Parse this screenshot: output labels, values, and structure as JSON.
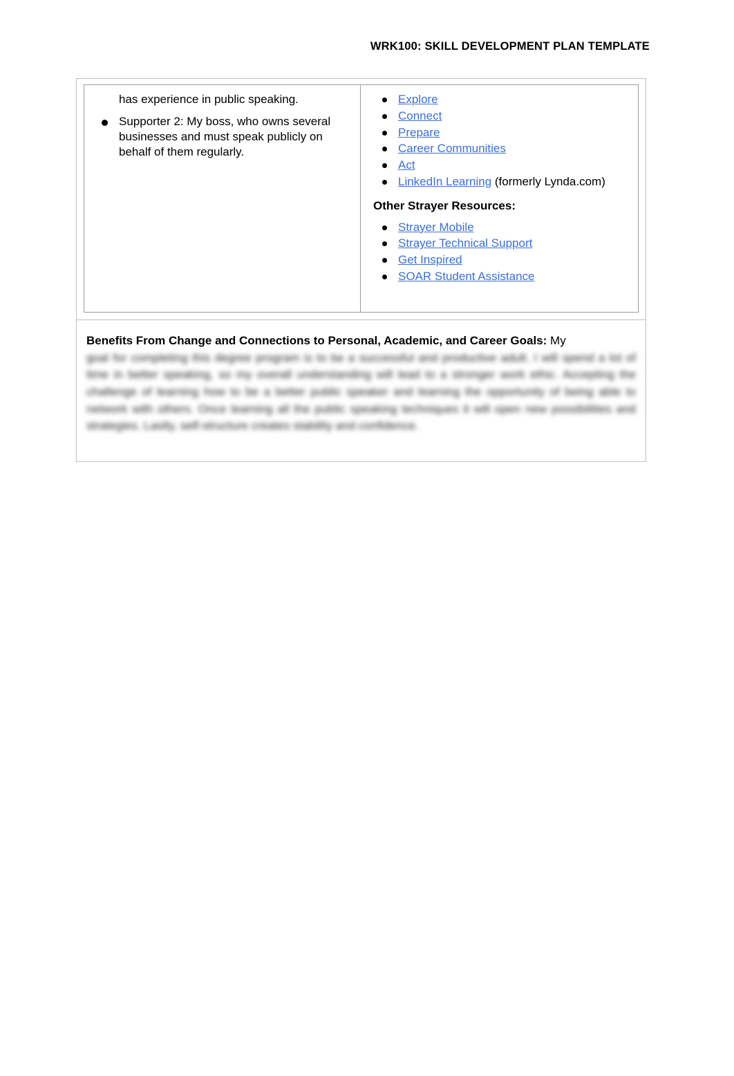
{
  "header": {
    "title": "WRK100: SKILL DEVELOPMENT PLAN TEMPLATE"
  },
  "table": {
    "left_cell": {
      "continued_text": "has experience in public speaking.",
      "bullets": [
        "Supporter 2: My boss, who owns several businesses and must speak publicly on behalf of them regularly."
      ]
    },
    "right_cell": {
      "resource_links": [
        {
          "label": "Explore",
          "suffix": ""
        },
        {
          "label": "Connect",
          "suffix": ""
        },
        {
          "label": "Prepare",
          "suffix": ""
        },
        {
          "label": "Career Communities",
          "suffix": ""
        },
        {
          "label": "Act",
          "suffix": ""
        },
        {
          "label": "LinkedIn Learning",
          "suffix": " (formerly Lynda.com)"
        }
      ],
      "other_heading": "Other Strayer Resources:",
      "other_links": [
        {
          "label": "Strayer Mobile",
          "suffix": ""
        },
        {
          "label": "Strayer Technical Support",
          "suffix": ""
        },
        {
          "label": "Get Inspired",
          "suffix": ""
        },
        {
          "label": "SOAR Student Assistance",
          "suffix": ""
        }
      ]
    }
  },
  "benefits": {
    "label": "Benefits From Change and Connections to Personal, Academic, and Career Goals:",
    "visible_text": "My",
    "blurred_text": "goal for completing this degree program is to be a successful and productive adult. I will spend a lot of time in better speaking, so my overall understanding will lead to a stronger work ethic. Accepting the challenge of learning how to be a better public speaker and learning the opportunity of being able to network with others. Once learning all the public speaking techniques it will open new possibilities and strategies. Lastly, self-structure creates stability and confidence."
  },
  "colors": {
    "link": "#3b6fd4",
    "border": "#9b9b9b",
    "outer_border": "#bfbfbf"
  }
}
